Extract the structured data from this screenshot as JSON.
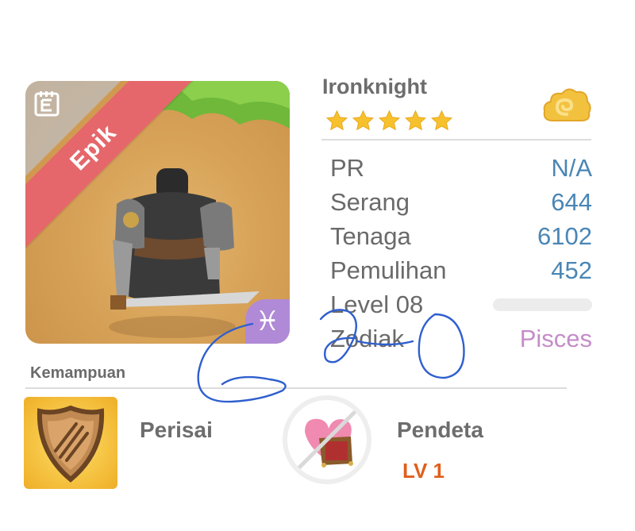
{
  "hero": {
    "name": "Ironknight",
    "rarity": "Epik",
    "stars": 5,
    "zodiac_symbol": "♓"
  },
  "stats": [
    {
      "label": "PR",
      "value": "N/A"
    },
    {
      "label": "Serang",
      "value": "644"
    },
    {
      "label": "Tenaga",
      "value": "6102"
    },
    {
      "label": "Pemulihan",
      "value": "452"
    },
    {
      "label": "Level 08",
      "value": ""
    },
    {
      "label": "Zodiak",
      "value": "Pisces"
    }
  ],
  "abilities": {
    "section_label": "Kemampuan",
    "skill_1": {
      "name": "Perisai"
    },
    "skill_2": {
      "name": "Pendeta",
      "level": "LV 1"
    }
  },
  "colors": {
    "value_blue": "#4a86b5",
    "pisces_pink": "#c48dc7",
    "ribbon_red": "#e5676b",
    "level_orange": "#e05f1c"
  },
  "icons": [
    "book-icon",
    "cloud-badge-icon",
    "star-icon",
    "pisces-icon",
    "shield-icon",
    "heart-chest-icon"
  ]
}
